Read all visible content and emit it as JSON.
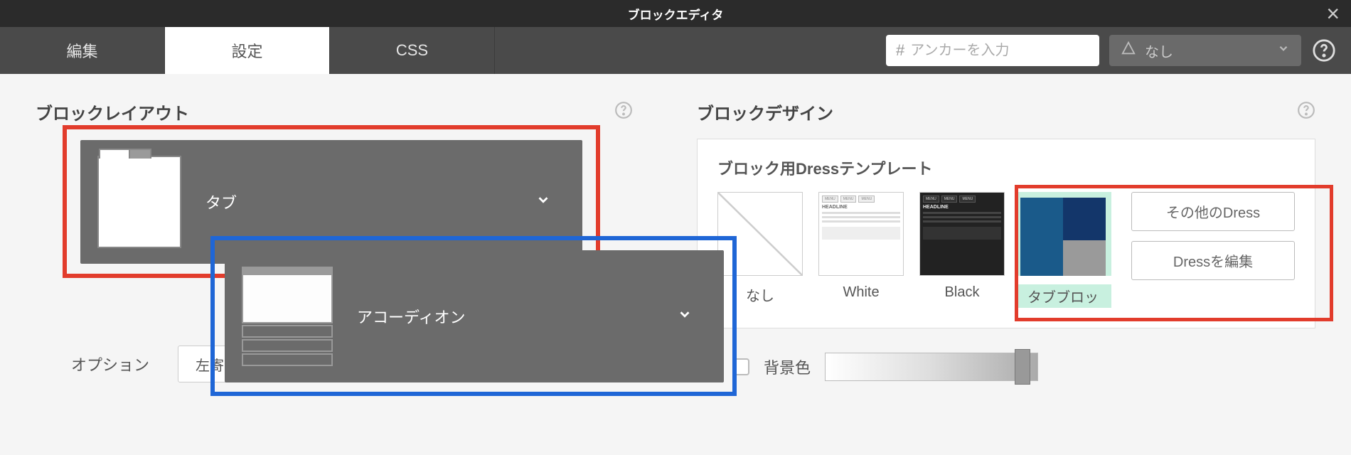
{
  "header": {
    "title": "ブロックエディタ"
  },
  "tabs": {
    "edit": "編集",
    "settings": "設定",
    "css": "CSS"
  },
  "toolbar": {
    "anchor_placeholder": "アンカーを入力",
    "mode_value": "なし"
  },
  "left": {
    "title": "ブロックレイアウト",
    "layouts": {
      "tab": "タブ",
      "accordion": "アコーディオン"
    }
  },
  "right": {
    "title": "ブロックデザイン",
    "dress_title": "ブロック用Dressテンプレート",
    "templates": {
      "none": "なし",
      "white": "White",
      "black": "Black",
      "tabblock": "タブブロッ"
    },
    "buttons": {
      "other": "その他のDress",
      "edit": "Dressを編集"
    }
  },
  "options": {
    "label": "オプション",
    "align_value": "左寄せ（クリック）",
    "bgcolor_label": "背景色"
  }
}
